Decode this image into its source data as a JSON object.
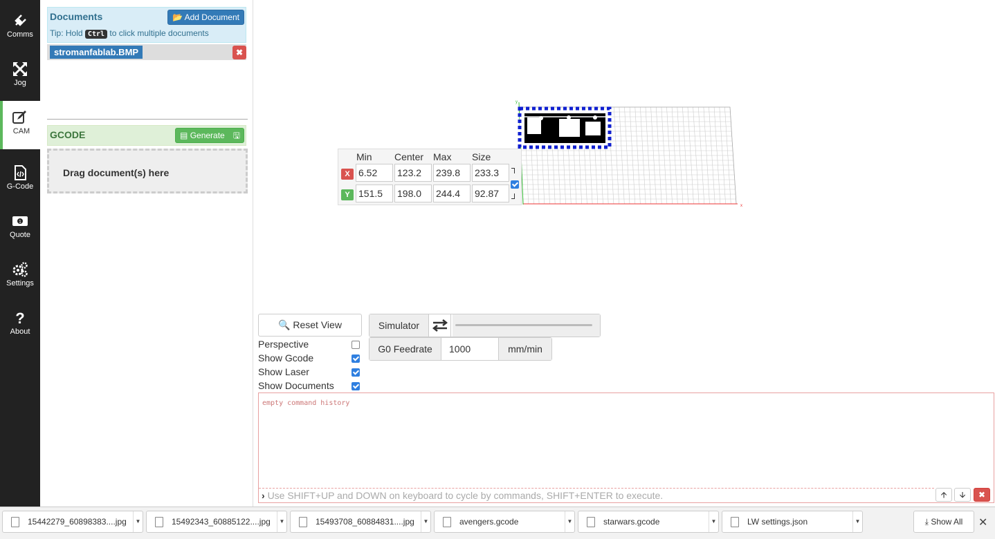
{
  "nav": {
    "items": [
      {
        "label": "Comms",
        "icon": "plug-icon"
      },
      {
        "label": "Jog",
        "icon": "move-icon"
      },
      {
        "label": "CAM",
        "icon": "edit-icon"
      },
      {
        "label": "G-Code",
        "icon": "code-file-icon"
      },
      {
        "label": "Quote",
        "icon": "money-icon"
      },
      {
        "label": "Settings",
        "icon": "gears-icon"
      },
      {
        "label": "About",
        "icon": "question-icon"
      }
    ]
  },
  "documents": {
    "title": "Documents",
    "add_label": "Add Document",
    "tip_before": "Tip: Hold",
    "tip_key": "Ctrl",
    "tip_after": "to click multiple documents",
    "items": [
      {
        "name": "stromanfablab.BMP"
      }
    ]
  },
  "gcode": {
    "title": "GCODE",
    "generate_label": "Generate",
    "drop_label": "Drag document(s) here"
  },
  "bounds": {
    "headers": [
      "Min",
      "Center",
      "Max",
      "Size"
    ],
    "x": {
      "axis": "X",
      "min": "6.52",
      "center": "123.2",
      "max": "239.8",
      "size": "233.3"
    },
    "y": {
      "axis": "Y",
      "min": "151.5",
      "center": "198.0",
      "max": "244.4",
      "size": "92.87"
    },
    "link_checked": true
  },
  "view": {
    "reset_label": "Reset View",
    "options": [
      {
        "label": "Perspective",
        "checked": false
      },
      {
        "label": "Show Gcode",
        "checked": true
      },
      {
        "label": "Show Laser",
        "checked": true
      },
      {
        "label": "Show Documents",
        "checked": true
      }
    ]
  },
  "simulator": {
    "label": "Simulator",
    "progress": 0
  },
  "feedrate": {
    "label": "G0 Feedrate",
    "value": "1000",
    "unit": "mm/min"
  },
  "console": {
    "history": "empty command history",
    "prompt": "Use SHIFT+UP and DOWN on keyboard to cycle by commands, SHIFT+ENTER to execute."
  },
  "downloads": {
    "items": [
      {
        "name": "15442279_60898383....jpg"
      },
      {
        "name": "15492343_60885122....jpg"
      },
      {
        "name": "15493708_60884831....jpg"
      },
      {
        "name": "avengers.gcode"
      },
      {
        "name": "starwars.gcode"
      },
      {
        "name": "LW settings.json"
      }
    ],
    "show_all": "Show All"
  },
  "colors": {
    "accent": "#337ab7",
    "success": "#5cb85c",
    "danger": "#d9534f",
    "nav_bg": "#222222"
  }
}
